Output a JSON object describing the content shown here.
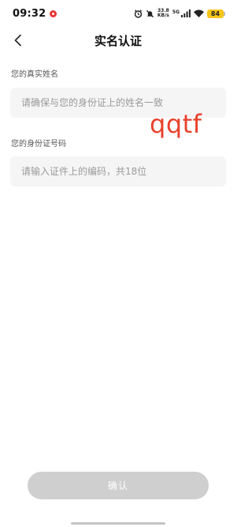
{
  "status_bar": {
    "time": "09:32",
    "net_speed_value": "33.8",
    "net_speed_unit": "KB/s",
    "signal_type": "5G",
    "battery": "84",
    "icons": [
      "alarm-icon",
      "mute-icon",
      "signal-icon",
      "wifi-icon",
      "battery-icon"
    ]
  },
  "nav": {
    "title": "实名认证",
    "back_icon": "chevron-left-icon"
  },
  "form": {
    "name_label": "您的真实姓名",
    "name_placeholder": "请确保与您的身份证上的姓名一致",
    "name_value": "",
    "id_label": "您的身份证号码",
    "id_placeholder": "请输入证件上的编码，共18位",
    "id_value": ""
  },
  "overlay_text": "qqtf",
  "confirm_label": "确认",
  "colors": {
    "accent_red": "#e8412b",
    "button_disabled": "#cfcfcf",
    "input_bg": "#f5f5f5",
    "battery": "#f5c518"
  }
}
